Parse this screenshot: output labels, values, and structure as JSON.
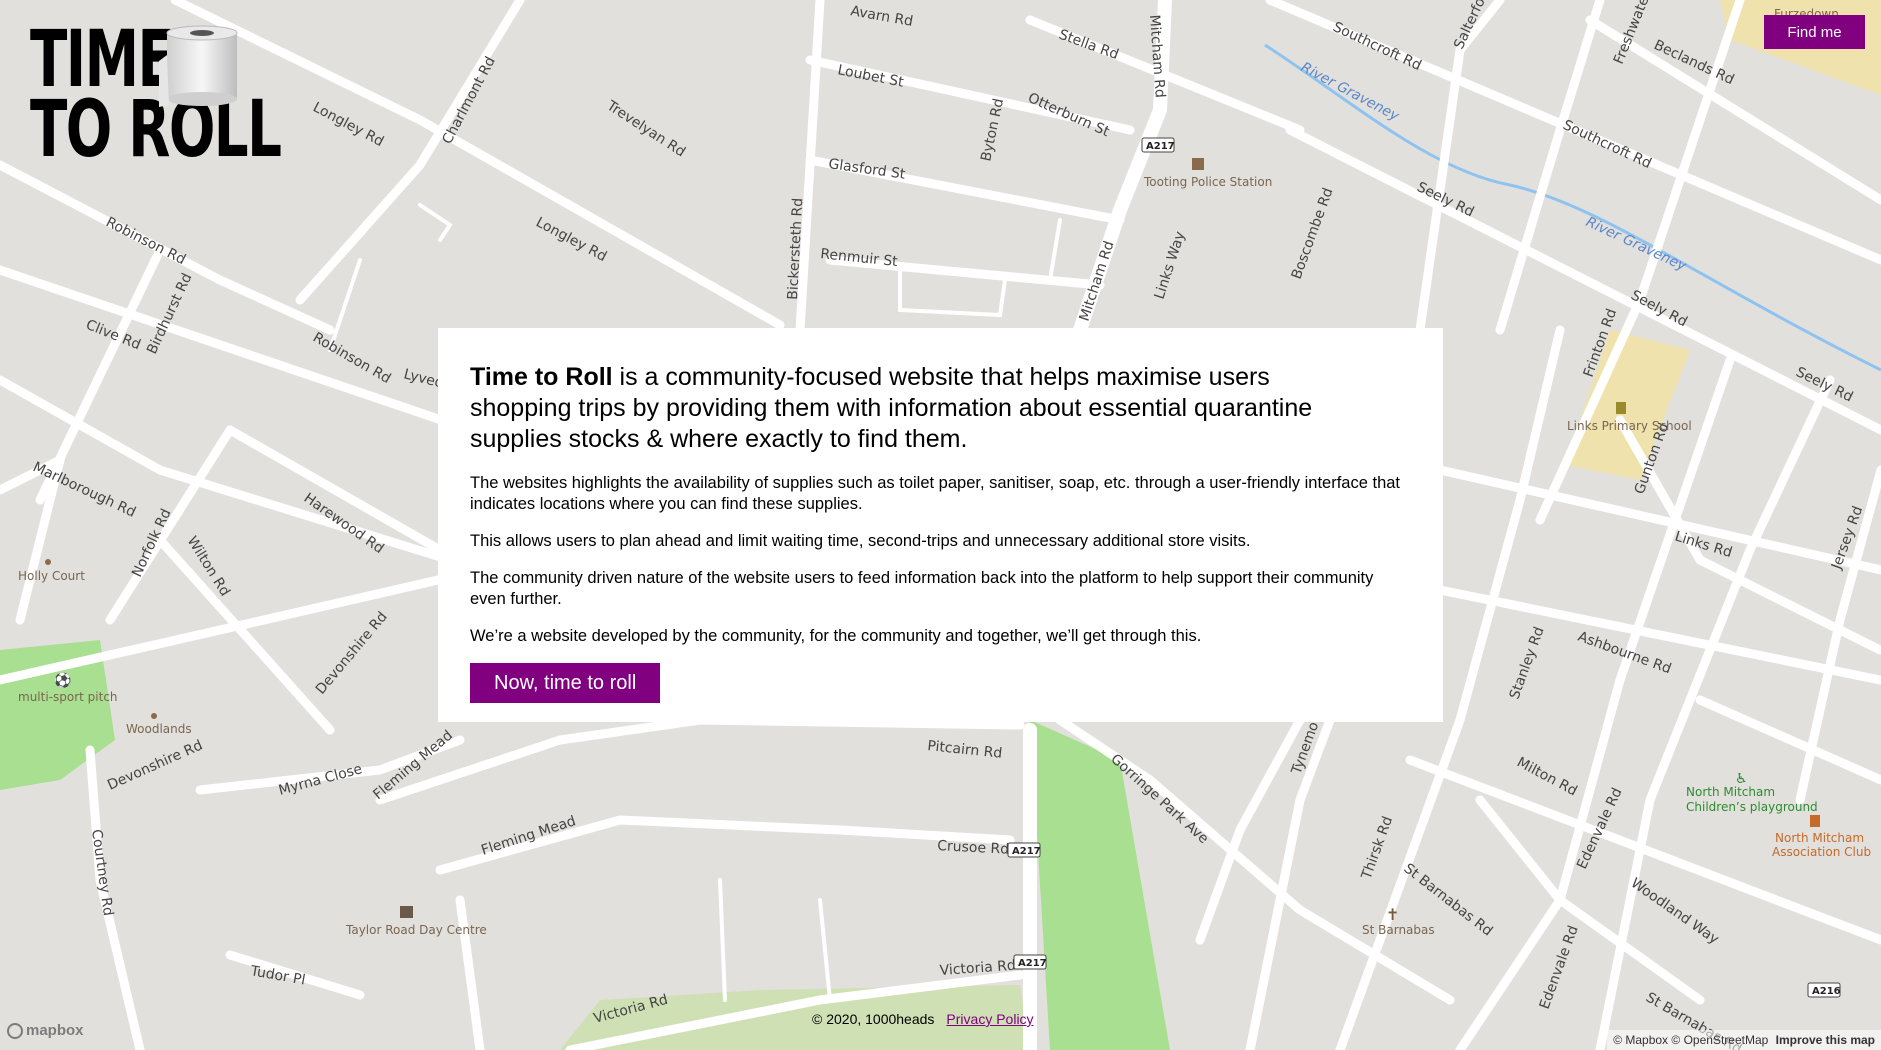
{
  "logo": {
    "line1": "TIME",
    "line2": "TO ROLL"
  },
  "header": {
    "find_me_label": "Find me"
  },
  "intro": {
    "brand": "Time to Roll",
    "lead": " is a community-focused website that helps maximise users shopping trips by providing them with information about essential quarantine supplies stocks & where exactly to find them.",
    "paragraphs": [
      "The websites highlights the availability of supplies such as toilet paper, sanitiser, soap, etc. through a user-friendly interface that indicates locations where you can find these supplies.",
      "This allows users to plan ahead and limit waiting time, second-trips and unnecessary additional store visits.",
      "The community driven nature of the website users to feed information back into the platform to help support their community even further.",
      "We’re a website developed by the community, for the community and together, we’ll get through this."
    ],
    "cta_label": "Now, time to roll"
  },
  "footer": {
    "copyright": "© 2020, 1000heads",
    "privacy_label": "Privacy Policy"
  },
  "map_attribution": {
    "mapbox": "© Mapbox",
    "osm": "© OpenStreetMap",
    "improve": "Improve this map"
  },
  "mapbox_logo": "mapbox",
  "map": {
    "streets": [
      "Longley Rd",
      "Charlmont Rd",
      "Trevelyan Rd",
      "Bickersteth Rd",
      "Avarn Rd",
      "Loubet St",
      "Stella Rd",
      "Mitcham Rd",
      "Southcroft Rd",
      "Salterford Rd",
      "Freshwater Rd",
      "Beclands Rd",
      "Robinson Rd",
      "Birdhurst Rd",
      "Clive Rd",
      "Glasford St",
      "Byton Rd",
      "Otterburn St",
      "Renmuir St",
      "Links Way",
      "Boscombe Rd",
      "Seely Rd",
      "Frinton Rd",
      "Gunton Rd",
      "Links Rd",
      "Marlborough Rd",
      "Norfolk Rd",
      "Wilton Rd",
      "Harewood Rd",
      "Devonshire Rd",
      "Myrna Close",
      "Fleming Mead",
      "Courtney Rd",
      "Pitcairn Rd",
      "Crusoe Rd",
      "Victoria Rd",
      "Tudor Pl",
      "Gorringe Park Ave",
      "Tynemouth",
      "Thirsk Rd",
      "Stanley Rd",
      "Ashbourne Rd",
      "Milton Rd",
      "Edenvale Rd",
      "Woodland Way",
      "St Barnabas Rd",
      "Jersey Rd",
      "Lyveden"
    ],
    "rivers": [
      "River Graveney"
    ],
    "pois": [
      "Tooting Police Station",
      "Links Primary School",
      "Holly Court",
      "multi-sport pitch",
      "Woodlands",
      "Taylor Road Day Centre",
      "St Barnabas",
      "North Mitcham Children's playground",
      "North Mitcham Association Club",
      "Furzedown"
    ],
    "shields": [
      "A217",
      "A216"
    ]
  },
  "colors": {
    "brand": "#800080",
    "map_bg": "#e2e0dd",
    "road": "#ffffff",
    "park": "#a9df90",
    "school": "#efe2ad",
    "river": "#8fc3ef"
  }
}
